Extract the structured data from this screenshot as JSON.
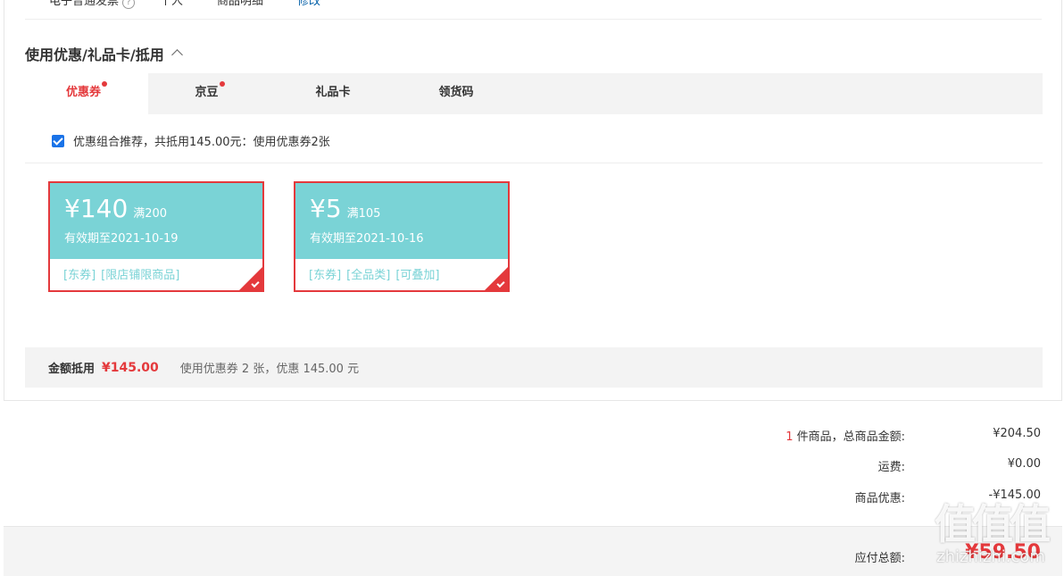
{
  "invoice": {
    "type": "电子普通发票",
    "title": "个人",
    "content": "商品明细",
    "modify": "修改"
  },
  "section": {
    "title": "使用优惠/礼品卡/抵用"
  },
  "tabs": [
    {
      "label": "优惠券",
      "active": true,
      "dot": true
    },
    {
      "label": "京豆",
      "active": false,
      "dot": true
    },
    {
      "label": "礼品卡",
      "active": false,
      "dot": false
    },
    {
      "label": "领货码",
      "active": false,
      "dot": false
    }
  ],
  "recommend": {
    "checked": true,
    "text": "优惠组合推荐，共抵用145.00元：使用优惠券2张"
  },
  "coupons": [
    {
      "amount": "¥140",
      "condition": "满200",
      "expire": "有效期至2021-10-19",
      "tags": [
        "[东券]",
        "[限店铺限商品]"
      ],
      "selected": true
    },
    {
      "amount": "¥5",
      "condition": "满105",
      "expire": "有效期至2021-10-16",
      "tags": [
        "[东券]",
        "[全品类]",
        "[可叠加]"
      ],
      "selected": true
    }
  ],
  "summary": {
    "label": "金额抵用",
    "amount": "¥145.00",
    "description": "使用优惠券 2 张，优惠 145.00 元"
  },
  "totals": {
    "count": "1",
    "count_suffix": "件商品，总商品金额:",
    "goods_total": "¥204.50",
    "shipping_label": "运费:",
    "shipping": "¥0.00",
    "discount_label": "商品优惠:",
    "discount": "-¥145.00"
  },
  "payment": {
    "label": "应付总额:",
    "value": "¥59.50"
  },
  "watermark": {
    "site": "zhizhizhi.com"
  },
  "colors": {
    "accent": "#e4393c",
    "coupon": "#7ad3d6",
    "link": "#005ea7"
  }
}
